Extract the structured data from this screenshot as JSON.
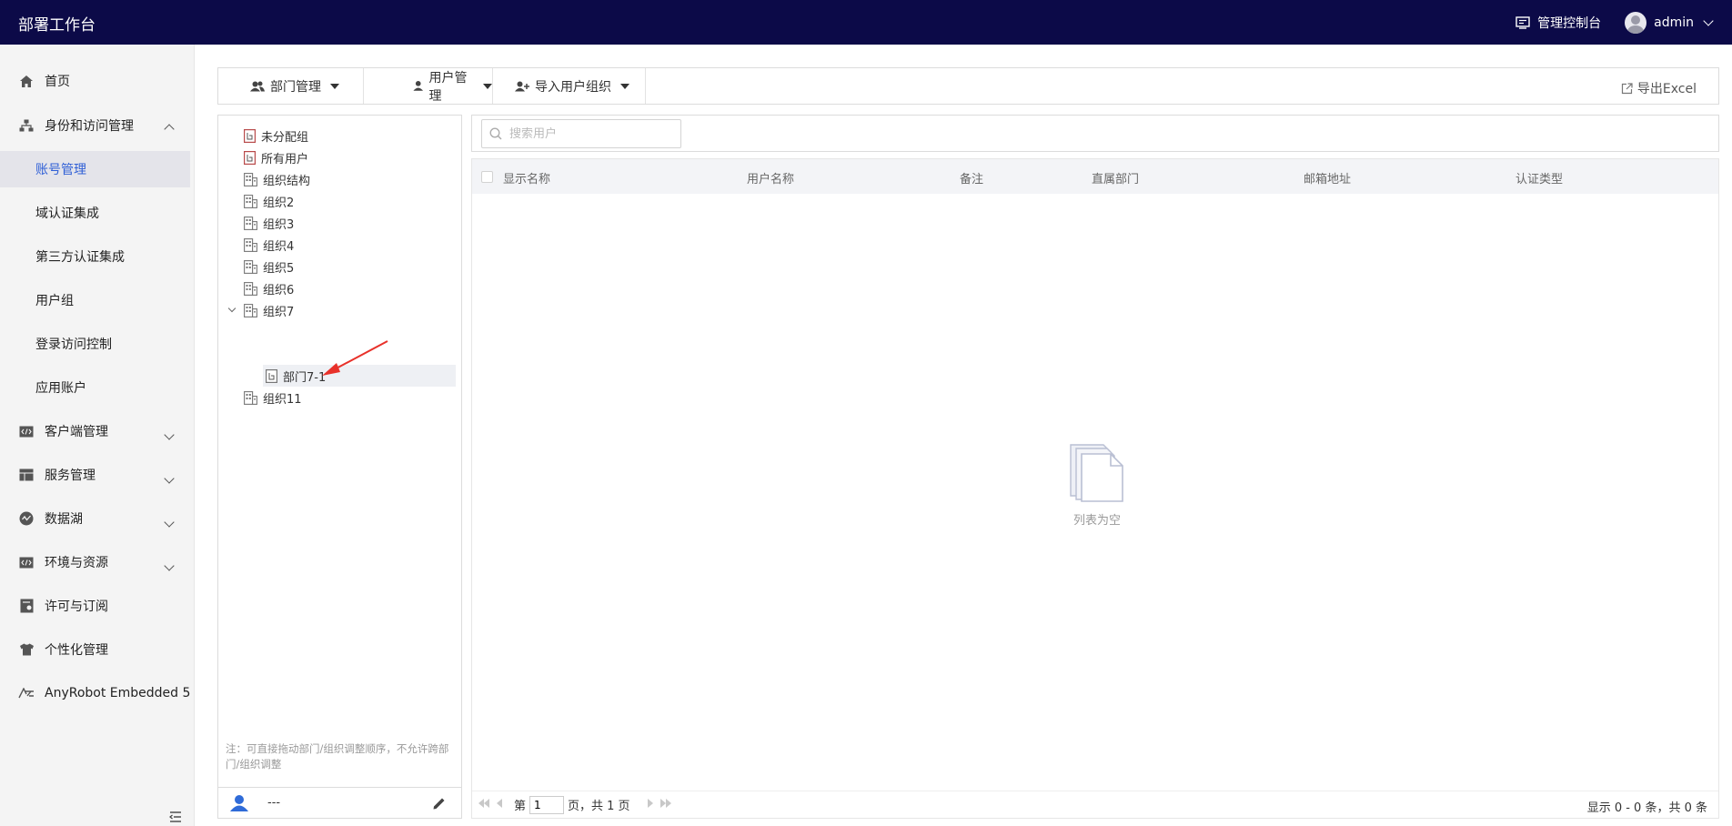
{
  "app": {
    "title": "部署工作台"
  },
  "header": {
    "console_label": "管理控制台",
    "user_name": "admin"
  },
  "sidebar": {
    "items": [
      {
        "label": "首页",
        "icon": "home-icon"
      },
      {
        "label": "身份和访问管理",
        "icon": "org-chart-icon",
        "expanded": true
      },
      {
        "label": "账号管理",
        "active": true
      },
      {
        "label": "域认证集成"
      },
      {
        "label": "第三方认证集成"
      },
      {
        "label": "用户组"
      },
      {
        "label": "登录访问控制"
      },
      {
        "label": "应用账户"
      },
      {
        "label": "客户端管理",
        "icon": "code-icon"
      },
      {
        "label": "服务管理",
        "icon": "layout-icon"
      },
      {
        "label": "数据湖",
        "icon": "data-lake-icon"
      },
      {
        "label": "环境与资源",
        "icon": "code-icon"
      },
      {
        "label": "许可与订阅",
        "icon": "license-icon"
      },
      {
        "label": "个性化管理",
        "icon": "shirt-icon"
      },
      {
        "label": "AnyRobot Embedded 5",
        "icon": "anyrobot-icon"
      }
    ]
  },
  "toolbar": {
    "dept_manage": "部门管理",
    "user_manage": "用户管理",
    "import_org": "导入用户组织",
    "export_excel": "导出Excel"
  },
  "tree": {
    "items": [
      {
        "label": "未分配组",
        "type": "department"
      },
      {
        "label": "所有用户",
        "type": "department"
      },
      {
        "label": "组织结构",
        "type": "organization"
      },
      {
        "label": "组织2",
        "type": "organization"
      },
      {
        "label": "组织3",
        "type": "organization"
      },
      {
        "label": "组织4",
        "type": "organization"
      },
      {
        "label": "组织5",
        "type": "organization"
      },
      {
        "label": "组织6",
        "type": "organization"
      },
      {
        "label": "组织7",
        "type": "organization",
        "expanded": true
      },
      {
        "label": "部门7-1",
        "type": "department",
        "selected": true
      },
      {
        "label": "组织11",
        "type": "organization"
      }
    ],
    "note": "注：可直接拖动部门/组织调整顺序，不允许跨部门/组织调整",
    "footer_user": "---"
  },
  "search": {
    "placeholder": "搜索用户"
  },
  "table": {
    "columns": [
      "显示名称",
      "用户名称",
      "备注",
      "直属部门",
      "邮箱地址",
      "认证类型"
    ],
    "rows": [],
    "empty_text": "列表为空"
  },
  "pagination": {
    "prefix": "第",
    "page": "1",
    "suffix": "页，共 1 页",
    "summary": "显示 0 - 0 条，共 0 条"
  },
  "colors": {
    "topbar": "#0c0a48",
    "active": "#2f5fd6",
    "annotation_arrow": "#e8312a"
  }
}
